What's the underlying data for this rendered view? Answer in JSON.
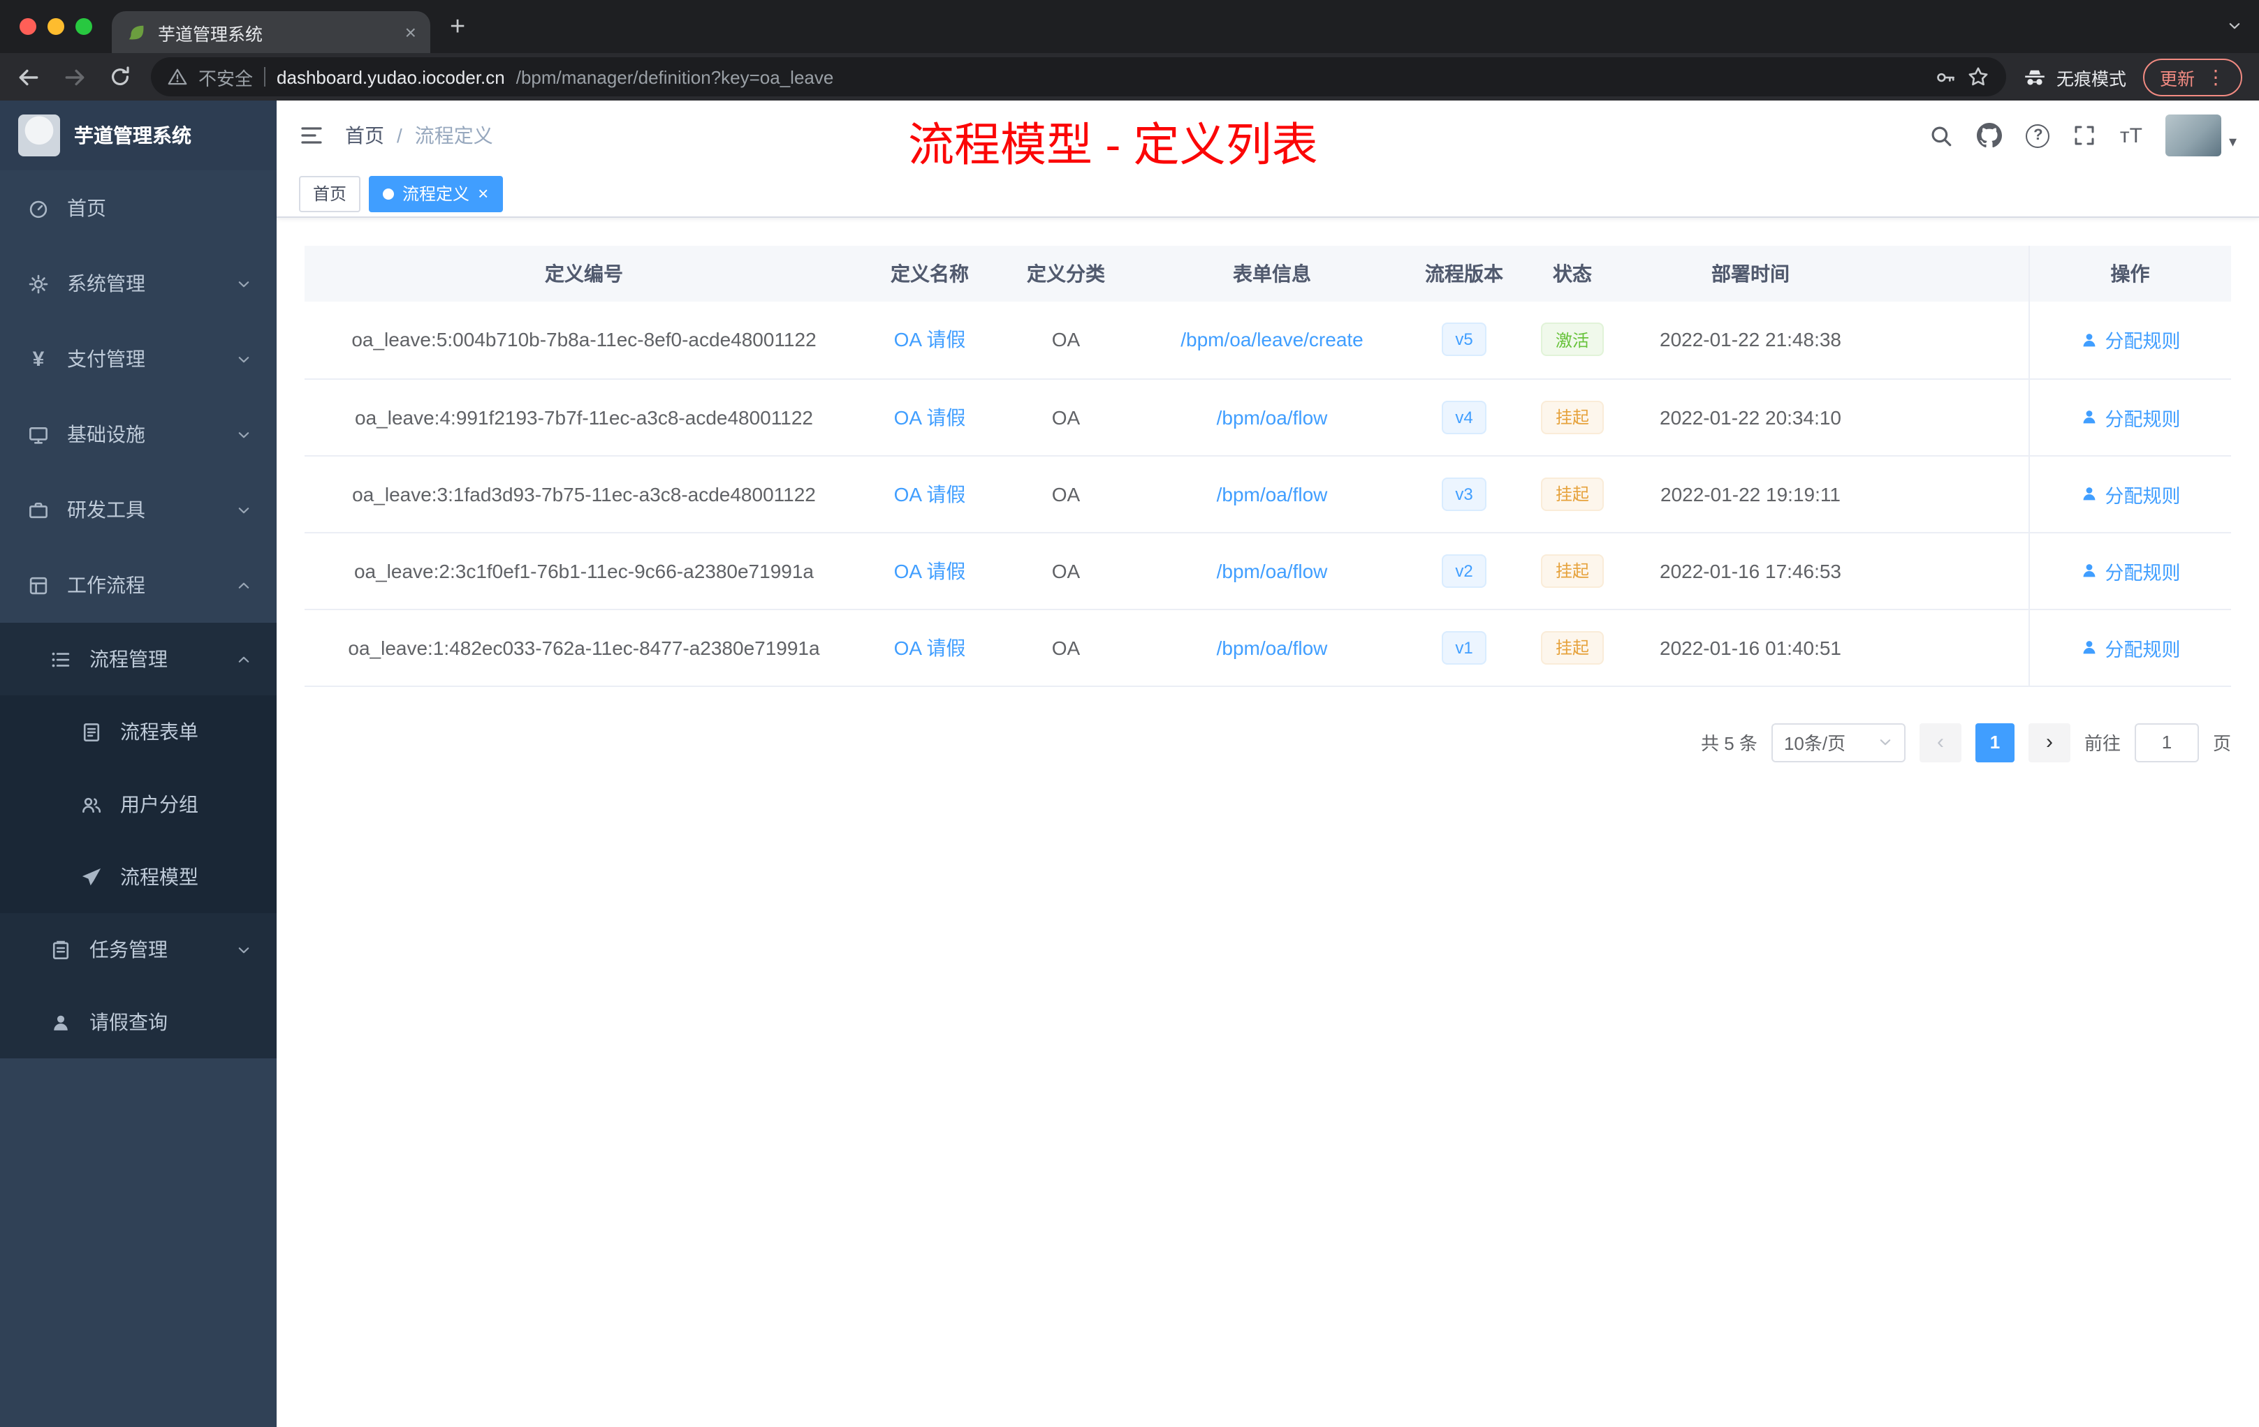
{
  "colors": {
    "accent": "#409eff",
    "status_active": "#67c23a",
    "status_suspended": "#e6a23c",
    "annotation_red": "#fb0606",
    "sidebar_bg": "#304156",
    "submenu_bg": "#1f2d3d"
  },
  "icons": {
    "close": "×",
    "plus": "+",
    "kebab": "⋮",
    "prev": "‹",
    "next": "›",
    "caret_down": "▾",
    "fontsize": "тT",
    "question": "?",
    "yen": "¥"
  },
  "browser": {
    "tab_title": "芋道管理系统",
    "security_label": "不安全",
    "url_host": "dashboard.yudao.iocoder.cn",
    "url_path": "/bpm/manager/definition?key=oa_leave",
    "incognito_label": "无痕模式",
    "update_label": "更新"
  },
  "sidebar": {
    "title": "芋道管理系统",
    "items": {
      "home": "首页",
      "system": "系统管理",
      "payment": "支付管理",
      "infra": "基础设施",
      "devtools": "研发工具",
      "workflow": "工作流程",
      "process_mgmt": "流程管理",
      "process_form": "流程表单",
      "user_group": "用户分组",
      "process_model": "流程模型",
      "task_mgmt": "任务管理",
      "leave_query": "请假查询"
    }
  },
  "header": {
    "breadcrumb_home": "首页",
    "breadcrumb_separator": "/",
    "breadcrumb_current": "流程定义",
    "annotation": "流程模型 - 定义列表"
  },
  "tags_view": {
    "home": "首页",
    "active": "流程定义"
  },
  "table": {
    "headers": [
      "定义编号",
      "定义名称",
      "定义分类",
      "表单信息",
      "流程版本",
      "状态",
      "部署时间",
      "操作"
    ],
    "action_label": "分配规则",
    "rows": [
      {
        "id": "oa_leave:5:004b710b-7b8a-11ec-8ef0-acde48001122",
        "name": "OA 请假",
        "category": "OA",
        "form": "/bpm/oa/leave/create",
        "version": "v5",
        "status": "激活",
        "time": "2022-01-22 21:48:38"
      },
      {
        "id": "oa_leave:4:991f2193-7b7f-11ec-a3c8-acde48001122",
        "name": "OA 请假",
        "category": "OA",
        "form": "/bpm/oa/flow",
        "version": "v4",
        "status": "挂起",
        "time": "2022-01-22 20:34:10"
      },
      {
        "id": "oa_leave:3:1fad3d93-7b75-11ec-a3c8-acde48001122",
        "name": "OA 请假",
        "category": "OA",
        "form": "/bpm/oa/flow",
        "version": "v3",
        "status": "挂起",
        "time": "2022-01-22 19:19:11"
      },
      {
        "id": "oa_leave:2:3c1f0ef1-76b1-11ec-9c66-a2380e71991a",
        "name": "OA 请假",
        "category": "OA",
        "form": "/bpm/oa/flow",
        "version": "v2",
        "status": "挂起",
        "time": "2022-01-16 17:46:53"
      },
      {
        "id": "oa_leave:1:482ec033-762a-11ec-8477-a2380e71991a",
        "name": "OA 请假",
        "category": "OA",
        "form": "/bpm/oa/flow",
        "version": "v1",
        "status": "挂起",
        "time": "2022-01-16 01:40:51"
      }
    ]
  },
  "pagination": {
    "total": "共 5 条",
    "page_size": "10条/页",
    "current_page": "1",
    "goto_label": "前往",
    "goto_value": "1",
    "page_unit": "页"
  }
}
